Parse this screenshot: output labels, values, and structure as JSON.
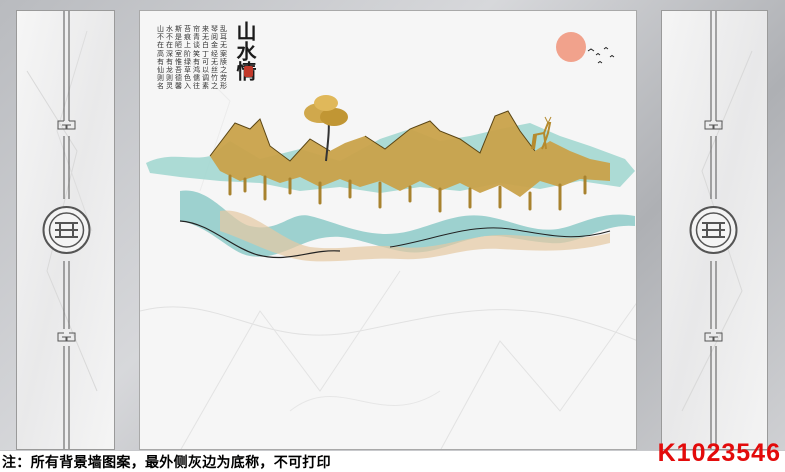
{
  "artwork": {
    "title_calligraphy": "山水情",
    "poem_columns": [
      "山不在高有仙则名",
      "水不在深有龙则灵",
      "斯是陋室惟吾德馨",
      "苔痕上阶绿草色入",
      "帘青谈笑有鸿儒往",
      "来无白丁可以调素",
      "琴阅金经无丝竹之",
      "乱耳无案牍之劳形"
    ],
    "colors": {
      "gold": "#c9a24a",
      "teal": "#8fcfc8",
      "sun": "#f1a28c",
      "frame_gray": "#b9bbbf"
    }
  },
  "notice": {
    "text": "注：所有背景墙图案，最外侧灰边为底称，不可打印"
  },
  "product_code": "K1023546"
}
